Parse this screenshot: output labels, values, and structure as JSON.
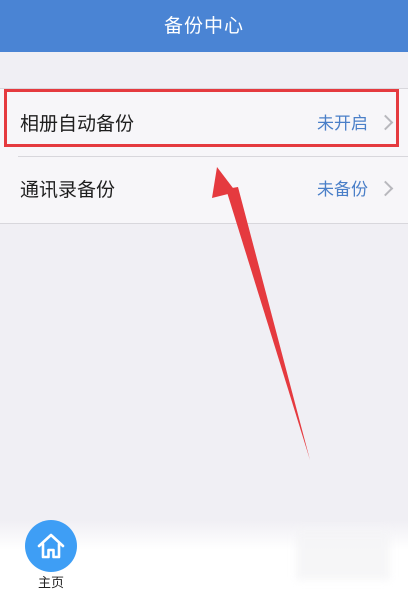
{
  "header": {
    "title": "备份中心"
  },
  "list": {
    "items": [
      {
        "label": "相册自动备份",
        "value": "未开启"
      },
      {
        "label": "通讯录备份",
        "value": "未备份"
      }
    ]
  },
  "bottom": {
    "home_label": "主页"
  },
  "colors": {
    "header_bg": "#4a84d4",
    "value_text": "#4a7fc8",
    "highlight": "#e53a3f",
    "home_button": "#3e9ef5"
  },
  "icons": {
    "chevron": "chevron-right-icon",
    "home": "home-icon"
  }
}
